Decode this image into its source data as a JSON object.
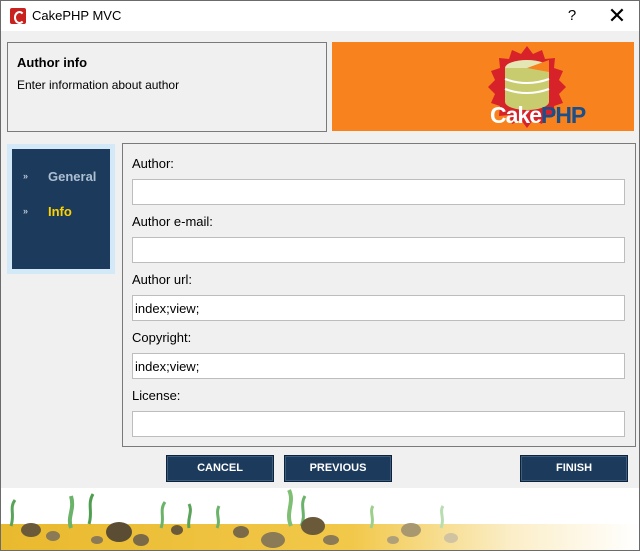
{
  "window": {
    "title": "CakePHP MVC",
    "help_glyph": "?",
    "close_glyph": "✕"
  },
  "header": {
    "title": "Author info",
    "subtitle": "Enter information about author"
  },
  "logo": {
    "text_cake": "Cake",
    "text_php": "PHP"
  },
  "nav": {
    "items": [
      {
        "label": "General",
        "arrow": "»"
      },
      {
        "label": "Info",
        "arrow": "»"
      }
    ]
  },
  "form": {
    "author": {
      "label": "Author:",
      "value": ""
    },
    "email": {
      "label": "Author e-mail:",
      "value": ""
    },
    "url": {
      "label": "Author url:",
      "value": "index;view;"
    },
    "copyright": {
      "label": "Copyright:",
      "value": "index;view;"
    },
    "license": {
      "label": "License:",
      "value": ""
    }
  },
  "buttons": {
    "cancel": "CANCEL",
    "previous": "PREVIOUS",
    "finish": "FINISH"
  },
  "colors": {
    "accent_orange": "#f7821e",
    "navy": "#1b3a5c",
    "active_nav": "#ffd200"
  }
}
